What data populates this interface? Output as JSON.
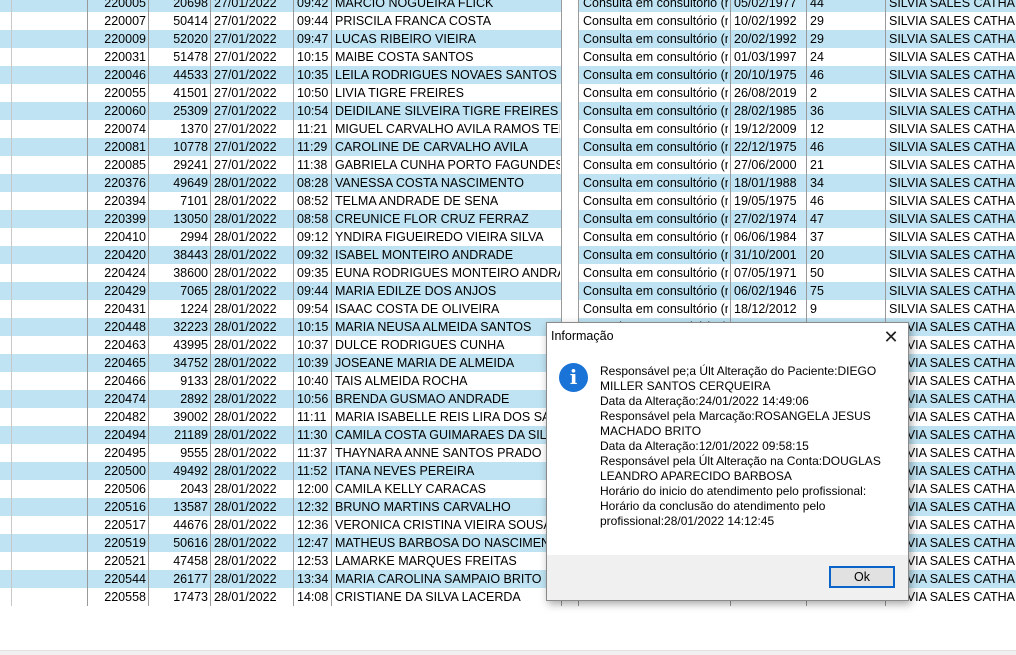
{
  "rows": [
    {
      "id": "220005",
      "code": "20698",
      "date": "27/01/2022",
      "time": "09:42",
      "name": "MARCIO NOGUEIRA FLICK",
      "tipo": "Consulta em consultório (n",
      "nasc": "05/02/1977",
      "idade": "44",
      "prof": "SILVIA SALES CATHALA"
    },
    {
      "id": "220007",
      "code": "50414",
      "date": "27/01/2022",
      "time": "09:44",
      "name": "PRISCILA FRANCA COSTA",
      "tipo": "Consulta em consultório (n",
      "nasc": "10/02/1992",
      "idade": "29",
      "prof": "SILVIA SALES CATHALA"
    },
    {
      "id": "220009",
      "code": "52020",
      "date": "27/01/2022",
      "time": "09:47",
      "name": "LUCAS RIBEIRO VIEIRA",
      "tipo": "Consulta em consultório (n",
      "nasc": "20/02/1992",
      "idade": "29",
      "prof": "SILVIA SALES CATHALA"
    },
    {
      "id": "220031",
      "code": "51478",
      "date": "27/01/2022",
      "time": "10:15",
      "name": "MAIBE COSTA SANTOS",
      "tipo": "Consulta em consultório (n",
      "nasc": "01/03/1997",
      "idade": "24",
      "prof": "SILVIA SALES CATHALA"
    },
    {
      "id": "220046",
      "code": "44533",
      "date": "27/01/2022",
      "time": "10:35",
      "name": "LEILA RODRIGUES NOVAES SANTOS",
      "tipo": "Consulta em consultório (n",
      "nasc": "20/10/1975",
      "idade": "46",
      "prof": "SILVIA SALES CATHALA"
    },
    {
      "id": "220055",
      "code": "41501",
      "date": "27/01/2022",
      "time": "10:50",
      "name": "LIVIA TIGRE FREIRES",
      "tipo": "Consulta em consultório (n",
      "nasc": "26/08/2019",
      "idade": "2",
      "prof": "SILVIA SALES CATHALA"
    },
    {
      "id": "220060",
      "code": "25309",
      "date": "27/01/2022",
      "time": "10:54",
      "name": "DEIDILANE SILVEIRA TIGRE FREIRES",
      "tipo": "Consulta em consultório (n",
      "nasc": "28/02/1985",
      "idade": "36",
      "prof": "SILVIA SALES CATHALA"
    },
    {
      "id": "220074",
      "code": "1370",
      "date": "27/01/2022",
      "time": "11:21",
      "name": "MIGUEL CARVALHO AVILA RAMOS TEIXE",
      "tipo": "Consulta em consultório (n",
      "nasc": "19/12/2009",
      "idade": "12",
      "prof": "SILVIA SALES CATHALA"
    },
    {
      "id": "220081",
      "code": "10778",
      "date": "27/01/2022",
      "time": "11:29",
      "name": "CAROLINE DE CARVALHO AVILA",
      "tipo": "Consulta em consultório (n",
      "nasc": "22/12/1975",
      "idade": "46",
      "prof": "SILVIA SALES CATHALA"
    },
    {
      "id": "220085",
      "code": "29241",
      "date": "27/01/2022",
      "time": "11:38",
      "name": "GABRIELA CUNHA PORTO FAGUNDES",
      "tipo": "Consulta em consultório (n",
      "nasc": "27/06/2000",
      "idade": "21",
      "prof": "SILVIA SALES CATHALA"
    },
    {
      "id": "220376",
      "code": "49649",
      "date": "28/01/2022",
      "time": "08:28",
      "name": "VANESSA COSTA NASCIMENTO",
      "tipo": "Consulta em consultório (n",
      "nasc": "18/01/1988",
      "idade": "34",
      "prof": "SILVIA SALES CATHALA"
    },
    {
      "id": "220394",
      "code": "7101",
      "date": "28/01/2022",
      "time": "08:52",
      "name": "TELMA ANDRADE DE SENA",
      "tipo": "Consulta em consultório (n",
      "nasc": "19/05/1975",
      "idade": "46",
      "prof": "SILVIA SALES CATHALA"
    },
    {
      "id": "220399",
      "code": "13050",
      "date": "28/01/2022",
      "time": "08:58",
      "name": "CREUNICE FLOR CRUZ FERRAZ",
      "tipo": "Consulta em consultório (n",
      "nasc": "27/02/1974",
      "idade": "47",
      "prof": "SILVIA SALES CATHALA"
    },
    {
      "id": "220410",
      "code": "2994",
      "date": "28/01/2022",
      "time": "09:12",
      "name": "YNDIRA FIGUEIREDO VIEIRA SILVA",
      "tipo": "Consulta em consultório (n",
      "nasc": "06/06/1984",
      "idade": "37",
      "prof": "SILVIA SALES CATHALA"
    },
    {
      "id": "220420",
      "code": "38443",
      "date": "28/01/2022",
      "time": "09:32",
      "name": "ISABEL MONTEIRO ANDRADE",
      "tipo": "Consulta em consultório (n",
      "nasc": "31/10/2001",
      "idade": "20",
      "prof": "SILVIA SALES CATHALA"
    },
    {
      "id": "220424",
      "code": "38600",
      "date": "28/01/2022",
      "time": "09:35",
      "name": "EUNA RODRIGUES MONTEIRO ANDRAD",
      "tipo": "Consulta em consultório (n",
      "nasc": "07/05/1971",
      "idade": "50",
      "prof": "SILVIA SALES CATHALA"
    },
    {
      "id": "220429",
      "code": "7065",
      "date": "28/01/2022",
      "time": "09:44",
      "name": "MARIA EDILZE DOS ANJOS",
      "tipo": "Consulta em consultório (n",
      "nasc": "06/02/1946",
      "idade": "75",
      "prof": "SILVIA SALES CATHALA"
    },
    {
      "id": "220431",
      "code": "1224",
      "date": "28/01/2022",
      "time": "09:54",
      "name": "ISAAC COSTA DE OLIVEIRA",
      "tipo": "Consulta em consultório (n",
      "nasc": "18/12/2012",
      "idade": "9",
      "prof": "SILVIA SALES CATHALA"
    },
    {
      "id": "220448",
      "code": "32223",
      "date": "28/01/2022",
      "time": "10:15",
      "name": "MARIA NEUSA ALMEIDA SANTOS",
      "tipo": "Consulta em consultório (n",
      "nasc": "",
      "idade": "",
      "prof": "SILVIA SALES CATHALA"
    },
    {
      "id": "220463",
      "code": "43995",
      "date": "28/01/2022",
      "time": "10:37",
      "name": "DULCE RODRIGUES CUNHA",
      "tipo": "",
      "nasc": "",
      "idade": "",
      "prof": "SILVIA SALES CATHALA"
    },
    {
      "id": "220465",
      "code": "34752",
      "date": "28/01/2022",
      "time": "10:39",
      "name": "JOSEANE MARIA DE ALMEIDA",
      "tipo": "",
      "nasc": "",
      "idade": "",
      "prof": "SILVIA SALES CATHALA"
    },
    {
      "id": "220466",
      "code": "9133",
      "date": "28/01/2022",
      "time": "10:40",
      "name": "TAIS ALMEIDA ROCHA",
      "tipo": "",
      "nasc": "",
      "idade": "",
      "prof": "SILVIA SALES CATHALA"
    },
    {
      "id": "220474",
      "code": "2892",
      "date": "28/01/2022",
      "time": "10:56",
      "name": "BRENDA GUSMAO ANDRADE",
      "tipo": "",
      "nasc": "",
      "idade": "",
      "prof": "SILVIA SALES CATHALA"
    },
    {
      "id": "220482",
      "code": "39002",
      "date": "28/01/2022",
      "time": "11:11",
      "name": "MARIA ISABELLE REIS LIRA DOS SANT",
      "tipo": "",
      "nasc": "",
      "idade": "",
      "prof": "SILVIA SALES CATHALA"
    },
    {
      "id": "220494",
      "code": "21189",
      "date": "28/01/2022",
      "time": "11:30",
      "name": "CAMILA COSTA GUIMARAES DA SILVA",
      "tipo": "",
      "nasc": "",
      "idade": "",
      "prof": "SILVIA SALES CATHALA"
    },
    {
      "id": "220495",
      "code": "9555",
      "date": "28/01/2022",
      "time": "11:37",
      "name": "THAYNARA ANNE SANTOS PRADO",
      "tipo": "",
      "nasc": "",
      "idade": "",
      "prof": "SILVIA SALES CATHALA"
    },
    {
      "id": "220500",
      "code": "49492",
      "date": "28/01/2022",
      "time": "11:52",
      "name": "ITANA NEVES PEREIRA",
      "tipo": "",
      "nasc": "",
      "idade": "",
      "prof": "SILVIA SALES CATHALA"
    },
    {
      "id": "220506",
      "code": "2043",
      "date": "28/01/2022",
      "time": "12:00",
      "name": "CAMILA KELLY CARACAS",
      "tipo": "",
      "nasc": "",
      "idade": "",
      "prof": "SILVIA SALES CATHALA"
    },
    {
      "id": "220516",
      "code": "13587",
      "date": "28/01/2022",
      "time": "12:32",
      "name": "BRUNO MARTINS CARVALHO",
      "tipo": "",
      "nasc": "",
      "idade": "",
      "prof": "SILVIA SALES CATHALA"
    },
    {
      "id": "220517",
      "code": "44676",
      "date": "28/01/2022",
      "time": "12:36",
      "name": "VERONICA CRISTINA VIEIRA SOUSA",
      "tipo": "",
      "nasc": "",
      "idade": "",
      "prof": "SILVIA SALES CATHALA"
    },
    {
      "id": "220519",
      "code": "50616",
      "date": "28/01/2022",
      "time": "12:47",
      "name": "MATHEUS BARBOSA DO NASCIMENTO",
      "tipo": "",
      "nasc": "",
      "idade": "",
      "prof": "SILVIA SALES CATHALA"
    },
    {
      "id": "220521",
      "code": "47458",
      "date": "28/01/2022",
      "time": "12:53",
      "name": "LAMARKE MARQUES FREITAS",
      "tipo": "",
      "nasc": "",
      "idade": "",
      "prof": "SILVIA SALES CATHALA"
    },
    {
      "id": "220544",
      "code": "26177",
      "date": "28/01/2022",
      "time": "13:34",
      "name": "MARIA CAROLINA SAMPAIO BRITO NAS",
      "tipo": "",
      "nasc": "",
      "idade": "",
      "prof": "SILVIA SALES CATHALA"
    },
    {
      "id": "220558",
      "code": "17473",
      "date": "28/01/2022",
      "time": "14:08",
      "name": "CRISTIANE DA SILVA LACERDA",
      "tipo": "",
      "nasc": "",
      "idade": "",
      "prof": "SILVIA SALES CATHALA"
    }
  ],
  "dialog": {
    "title": "Informação",
    "icon": "info-icon",
    "lines": [
      "Responsável pe;a Últ Alteração do Paciente:DIEGO",
      "MILLER SANTOS CERQUEIRA",
      "Data da Alteração:24/01/2022 14:49:06",
      "Responsável pela Marcação:ROSANGELA JESUS",
      "MACHADO BRITO",
      "Data da Alteração:12/01/2022 09:58:15",
      "Responsável pela Últ Alteração na Conta:DOUGLAS",
      "LEANDRO APARECIDO BARBOSA",
      "Horário do inicio do atendimento pelo profissional:",
      "Horário da conclusão do atendimento pelo",
      "profissional:28/01/2022 14:12:45"
    ],
    "ok_label": "Ok",
    "close_symbol": "✕"
  },
  "colors": {
    "row_alt": "#bfe3f2",
    "info_icon": "#1a73d6"
  }
}
